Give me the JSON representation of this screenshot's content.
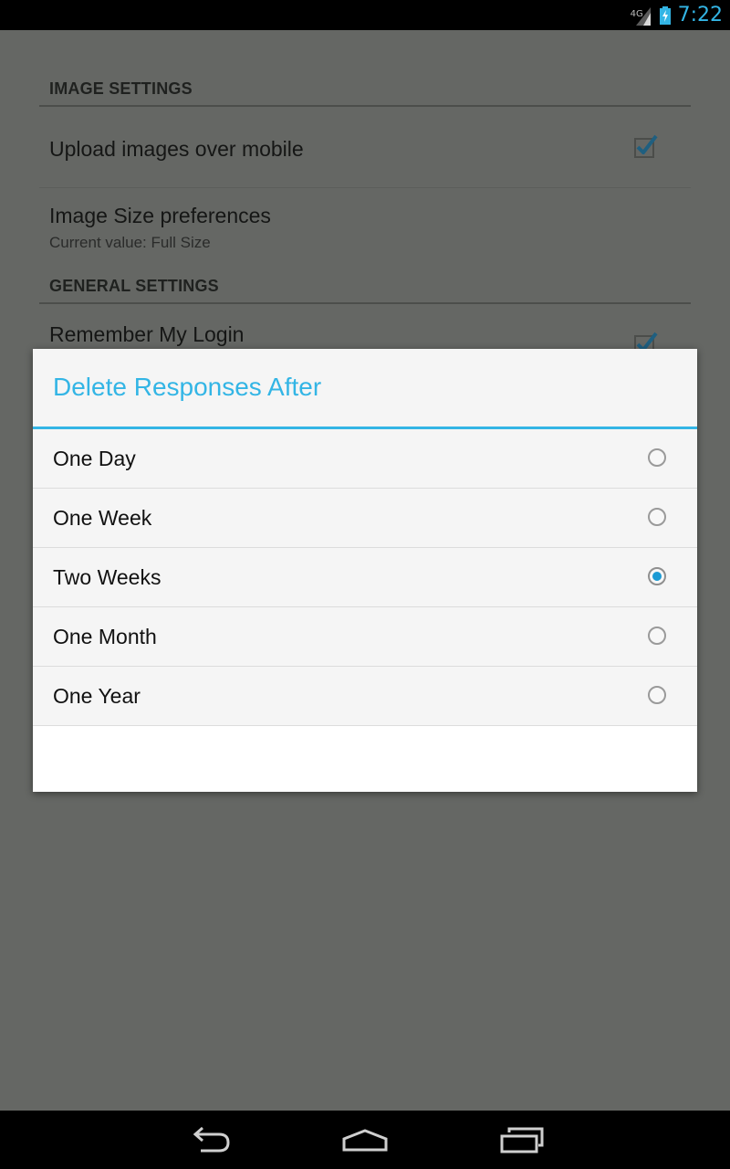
{
  "status_bar": {
    "network": "4G",
    "time": "7:22",
    "accent": "#33b5e5"
  },
  "settings": {
    "image_section": "IMAGE SETTINGS",
    "upload_title": "Upload images over mobile",
    "upload_checked": true,
    "image_size_title": "Image Size preferences",
    "image_size_summary": "Current value: Full Size",
    "general_section": "GENERAL SETTINGS",
    "remember_title": "Remember My Login",
    "remember_checked": true
  },
  "dialog": {
    "title": "Delete Responses After",
    "options": [
      {
        "label": "One Day",
        "selected": false
      },
      {
        "label": "One Week",
        "selected": false
      },
      {
        "label": "Two Weeks",
        "selected": true
      },
      {
        "label": "One Month",
        "selected": false
      },
      {
        "label": "One Year",
        "selected": false
      }
    ]
  },
  "nav": {
    "back": "back-icon",
    "home": "home-icon",
    "recents": "recents-icon"
  }
}
